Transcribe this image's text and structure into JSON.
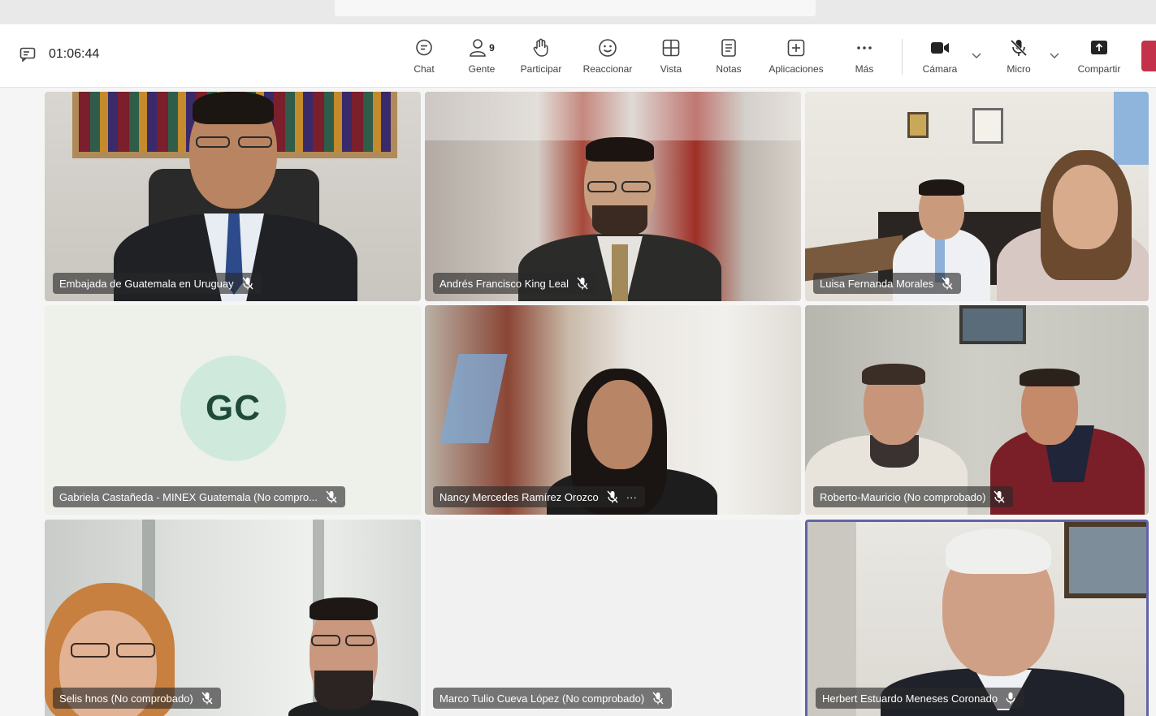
{
  "meeting": {
    "duration": "01:06:44"
  },
  "toolbar": {
    "chat": "Chat",
    "people": "Gente",
    "people_count": "9",
    "raise": "Participar",
    "react": "Reaccionar",
    "view": "Vista",
    "notes": "Notas",
    "apps": "Aplicaciones",
    "more": "Más",
    "camera": "Cámara",
    "mic": "Micro",
    "share": "Compartir"
  },
  "participants": [
    {
      "name": "Embajada de Guatemala en Uruguay",
      "muted": true
    },
    {
      "name": "Andrés Francisco King Leal",
      "muted": true
    },
    {
      "name": "Luisa Fernanda Morales",
      "muted": true
    },
    {
      "name": "Gabriela Castañeda - MINEX Guatemala (No compro...",
      "muted": true,
      "initials": "GC"
    },
    {
      "name": "Nancy Mercedes Ramírez Orozco",
      "muted": true,
      "more": "···"
    },
    {
      "name": "Roberto-Mauricio (No comprobado)",
      "muted": true
    },
    {
      "name": "Selis hnos (No comprobado)",
      "muted": true
    },
    {
      "name": "Marco Tulio Cueva López (No comprobado)",
      "muted": true
    },
    {
      "name": "Herbert Estuardo Meneses Coronado",
      "muted": false,
      "speaking": true
    }
  ],
  "colors": {
    "accent": "#6264a7",
    "leave": "#c4314b",
    "avatar_bg": "#cfe9dd",
    "avatar_text": "#1f4a39"
  },
  "icons": [
    "captions-icon",
    "chat-icon",
    "people-icon",
    "raise-hand-icon",
    "react-icon",
    "view-icon",
    "notes-icon",
    "apps-icon",
    "more-icon",
    "camera-icon",
    "mic-off-icon",
    "share-icon",
    "mic-muted-icon"
  ]
}
